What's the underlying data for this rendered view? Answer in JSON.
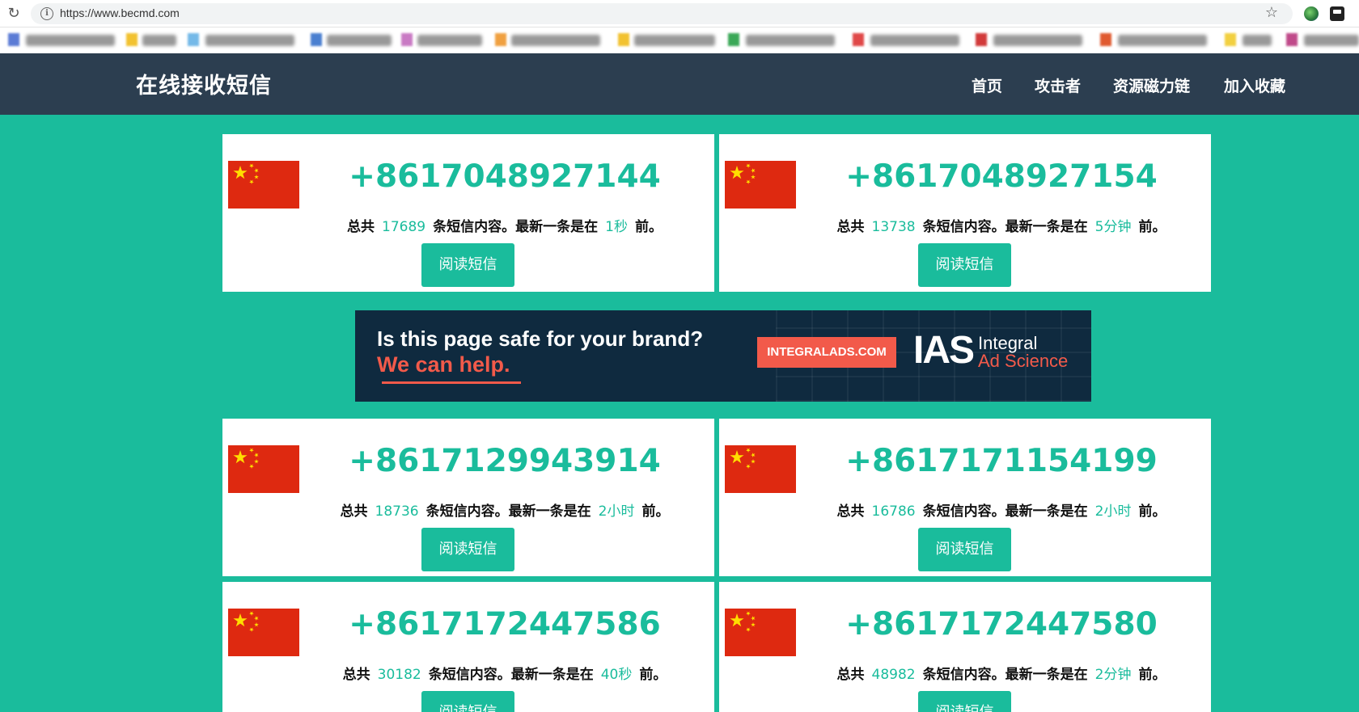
{
  "browser": {
    "url": "https://www.becmd.com"
  },
  "site": {
    "title": "在线接收短信",
    "nav": [
      "首页",
      "攻击者",
      "资源磁力链",
      "加入收藏"
    ]
  },
  "cards": [
    {
      "number": "+8617048927144",
      "prefix": "总共",
      "count": "17689",
      "middle": "条短信内容。最新一条是在",
      "time": "1秒",
      "suffix": "前。",
      "button": "阅读短信"
    },
    {
      "number": "+8617048927154",
      "prefix": "总共",
      "count": "13738",
      "middle": "条短信内容。最新一条是在",
      "time": "5分钟",
      "suffix": "前。",
      "button": "阅读短信"
    },
    {
      "number": "+8617129943914",
      "prefix": "总共",
      "count": "18736",
      "middle": "条短信内容。最新一条是在",
      "time": "2小时",
      "suffix": "前。",
      "button": "阅读短信"
    },
    {
      "number": "+8617171154199",
      "prefix": "总共",
      "count": "16786",
      "middle": "条短信内容。最新一条是在",
      "time": "2小时",
      "suffix": "前。",
      "button": "阅读短信"
    },
    {
      "number": "+8617172447586",
      "prefix": "总共",
      "count": "30182",
      "middle": "条短信内容。最新一条是在",
      "time": "40秒",
      "suffix": "前。",
      "button": "阅读短信"
    },
    {
      "number": "+8617172447580",
      "prefix": "总共",
      "count": "48982",
      "middle": "条短信内容。最新一条是在",
      "time": "2分钟",
      "suffix": "前。",
      "button": "阅读短信"
    }
  ],
  "ad": {
    "headline": "Is this page safe for your brand?",
    "tagline": "We can help.",
    "badge": "INTEGRALADS.COM",
    "logo": "IAS",
    "logo_line1": "Integral",
    "logo_line2": "Ad Science"
  },
  "colors": {
    "accent": "#1abc9c",
    "navbar": "#2c3e50",
    "flag_red": "#de2910",
    "flag_star": "#ffde00"
  }
}
